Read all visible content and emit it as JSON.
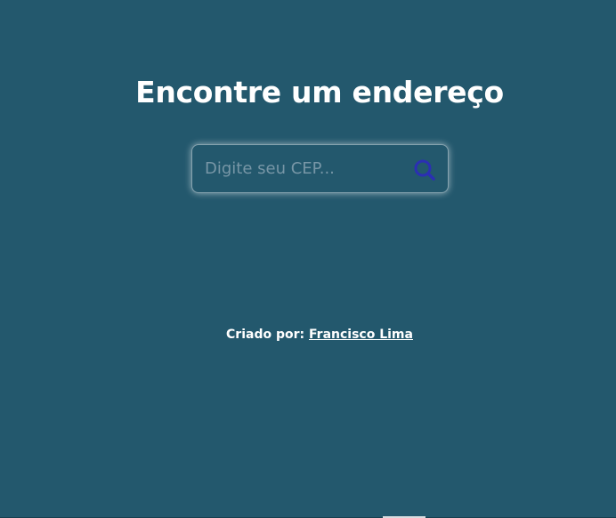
{
  "header": {
    "title": "Encontre um endereço"
  },
  "search": {
    "placeholder": "Digite seu CEP...",
    "value": "",
    "button_icon": "search-icon",
    "icon_color": "#2b2fb3"
  },
  "footer": {
    "credit_prefix": "Criado por:",
    "author_name": "Francisco Lima"
  },
  "colors": {
    "background": "#23586d",
    "text": "#ffffff"
  }
}
